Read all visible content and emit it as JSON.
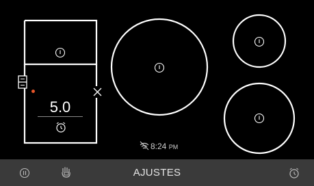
{
  "cooktop": {
    "zones": [
      {
        "id": "left-bridge",
        "power_level": "5.0",
        "active": true
      },
      {
        "id": "center-large",
        "active": false
      },
      {
        "id": "top-right",
        "active": false
      },
      {
        "id": "bottom-right",
        "active": false
      }
    ]
  },
  "status": {
    "time": "8:24",
    "ampm": "PM",
    "wifi_status": "disconnected"
  },
  "bottom_bar": {
    "settings_label": "AJUSTES"
  },
  "colors": {
    "background": "#000000",
    "line": "#ffffff",
    "bar": "#3a3a3a",
    "indicator": "#e8562a"
  },
  "icons": [
    "power-icon",
    "timer-icon",
    "close-icon",
    "bridge-zone-icon",
    "wifi-off-icon",
    "pause-icon",
    "lock-icon"
  ]
}
